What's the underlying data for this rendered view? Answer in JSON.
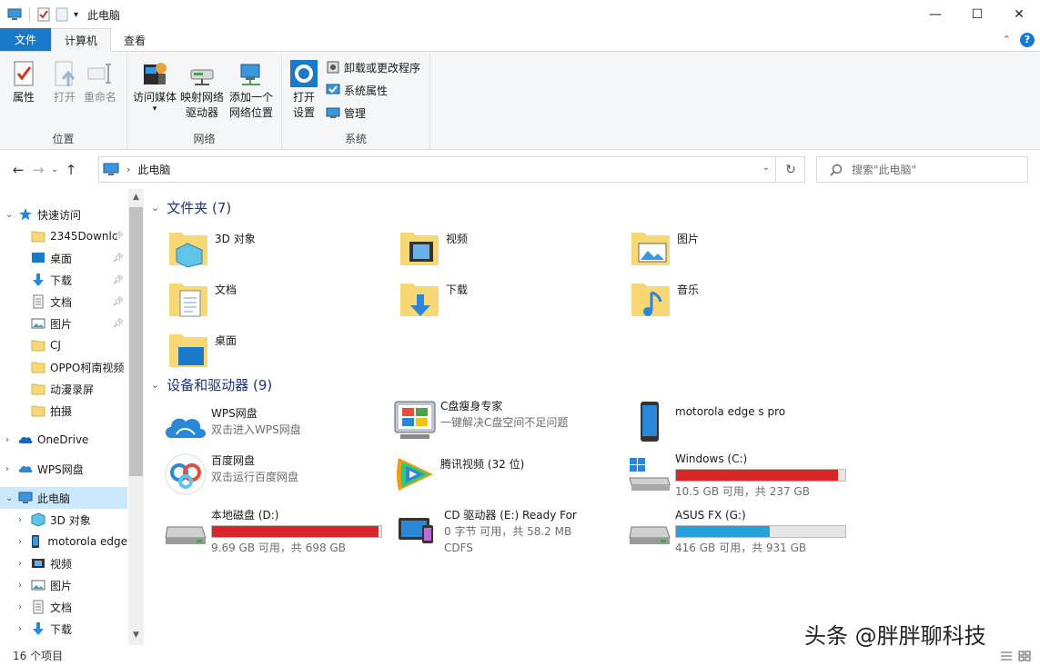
{
  "window": {
    "title": "此电脑",
    "minimize": "—",
    "maximize": "☐",
    "close": "✕"
  },
  "ribbon_tabs": {
    "file": "文件",
    "computer": "计算机",
    "view": "查看"
  },
  "ribbon": {
    "location": {
      "label": "位置",
      "properties": "属性",
      "open": "打开",
      "rename": "重命名"
    },
    "network": {
      "label": "网络",
      "media_line1": "访问媒体",
      "map_line1": "映射网络",
      "map_line2": "驱动器",
      "add_line1": "添加一个",
      "add_line2": "网络位置"
    },
    "system": {
      "label": "系统",
      "settings_line1": "打开",
      "settings_line2": "设置",
      "uninstall": "卸载或更改程序",
      "sys_props": "系统属性",
      "manage": "管理"
    }
  },
  "address": {
    "crumb": "此电脑"
  },
  "search": {
    "placeholder": "搜索\"此电脑\""
  },
  "sidebar": {
    "quick_access": "快速访问",
    "items": [
      {
        "label": "2345Downlc",
        "pinned": true
      },
      {
        "label": "桌面",
        "pinned": true
      },
      {
        "label": "下载",
        "pinned": true
      },
      {
        "label": "文档",
        "pinned": true
      },
      {
        "label": "图片",
        "pinned": true
      },
      {
        "label": "CJ",
        "pinned": false
      },
      {
        "label": "OPPO柯南视频",
        "pinned": false
      },
      {
        "label": "动漫录屏",
        "pinned": false
      },
      {
        "label": "拍摄",
        "pinned": false
      }
    ],
    "onedrive": "OneDrive",
    "wps": "WPS网盘",
    "this_pc": "此电脑",
    "pc_children": [
      "3D 对象",
      "motorola edge",
      "视频",
      "图片",
      "文档",
      "下载"
    ]
  },
  "folders": {
    "header": "文件夹 (7)",
    "items": [
      "3D 对象",
      "视频",
      "图片",
      "文档",
      "下载",
      "音乐",
      "桌面"
    ]
  },
  "devices": {
    "header": "设备和驱动器 (9)",
    "wps": {
      "name": "WPS网盘",
      "sub": "双击进入WPS网盘"
    },
    "cleaner": {
      "name": "C盘瘦身专家",
      "sub": "一键解决C盘空间不足问题"
    },
    "phone": {
      "name": "motorola edge s pro"
    },
    "baidu": {
      "name": "百度网盘",
      "sub": "双击运行百度网盘"
    },
    "tencent": {
      "name": "腾讯视频 (32 位)"
    },
    "c_drive": {
      "name": "Windows (C:)",
      "free": "10.5 GB 可用，共 237 GB",
      "used_fraction": 0.956
    },
    "d_drive": {
      "name": "本地磁盘 (D:)",
      "free": "9.69 GB 可用，共 698 GB",
      "used_fraction": 0.986
    },
    "e_drive": {
      "name": "CD 驱动器 (E:) Ready For",
      "free": "0 字节 可用，共 58.2 MB",
      "fs": "CDFS"
    },
    "g_drive": {
      "name": "ASUS FX (G:)",
      "free": "416 GB 可用，共 931 GB",
      "used_fraction": 0.553
    }
  },
  "colors": {
    "bar_full": "#da2626",
    "bar_normal": "#26a0da",
    "accent": "#1979ca"
  },
  "status": {
    "count": "16 个项目"
  },
  "watermark": "头条 @胖胖聊科技"
}
